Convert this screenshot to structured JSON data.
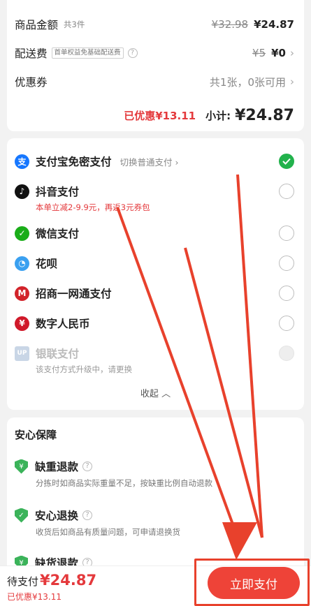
{
  "summary": {
    "goods_label": "商品金额",
    "goods_count": "共3件",
    "goods_original": "¥32.98",
    "goods_price": "¥24.87",
    "shipping_label": "配送费",
    "shipping_tag": "首单权益免基础配送费",
    "shipping_original": "¥5",
    "shipping_price": "¥0",
    "coupon_label": "优惠券",
    "coupon_info": "共1张，0张可用",
    "saved_text": "已优惠¥13.11",
    "subtotal_label": "小计:",
    "subtotal_value": "¥24.87"
  },
  "payments": {
    "methods": [
      {
        "name": "支付宝免密支付",
        "icon": "alipay-icon",
        "switch": "切换普通支付",
        "checked": true
      },
      {
        "name": "抖音支付",
        "icon": "douyin-icon",
        "note": "本单立减2-9.9元，再返3元券包"
      },
      {
        "name": "微信支付",
        "icon": "wechat-icon"
      },
      {
        "name": "花呗",
        "icon": "huabei-icon"
      },
      {
        "name": "招商一网通支付",
        "icon": "cmb-icon"
      },
      {
        "name": "数字人民币",
        "icon": "ecny-icon"
      },
      {
        "name": "银联支付",
        "icon": "unionpay-icon",
        "note": "该支付方式升级中，请更换",
        "disabled": true
      }
    ],
    "collapse_label": "收起"
  },
  "assurance": {
    "title": "安心保障",
    "items": [
      {
        "name": "缺重退款",
        "desc": "分拣时如商品实际重量不足，按缺重比例自动退款"
      },
      {
        "name": "安心退换",
        "desc": "收货后如商品有质量问题，可申请退换货"
      },
      {
        "name": "缺货退款"
      }
    ]
  },
  "bottom": {
    "due_label": "待支付",
    "due_value": "¥24.87",
    "saved_text": "已优惠¥13.11",
    "pay_button": "立即支付"
  },
  "colors": {
    "accent_red": "#e4393c",
    "check_green": "#22b24c",
    "annotation_red": "#e8412c"
  }
}
